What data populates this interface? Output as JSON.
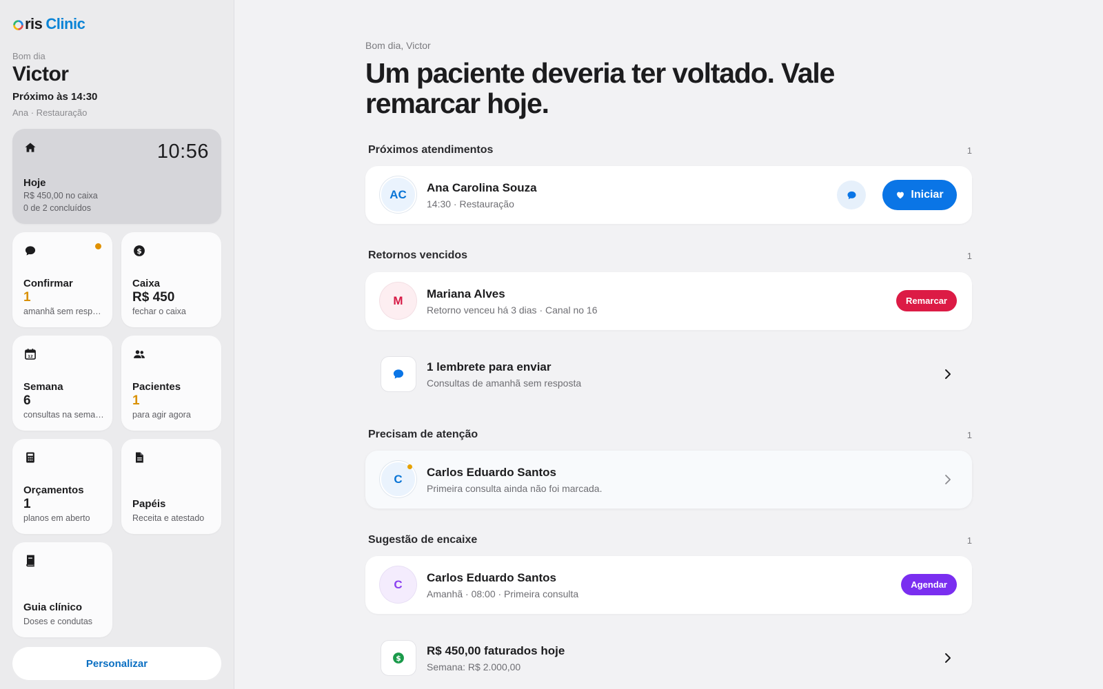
{
  "brand": {
    "prefix": "ris",
    "name": "Clinic"
  },
  "sidebar": {
    "greeting": "Bom dia",
    "user_name": "Victor",
    "next_appointment": "Próximo às 14:30",
    "next_detail": "Ana · Restauração",
    "today": {
      "title": "Hoje",
      "time": "10:56",
      "cash": "R$ 450,00 no caixa",
      "progress": "0 de 2 concluídos"
    },
    "tiles": [
      {
        "title": "Confirmar",
        "value": "1",
        "sub": "amanhã sem resposta",
        "icon": "chat-bubble-icon"
      },
      {
        "title": "Caixa",
        "value": "R$ 450",
        "sub": "fechar o caixa",
        "icon": "dollar-coin-icon"
      },
      {
        "title": "Semana",
        "value": "6",
        "sub": "consultas na semana",
        "icon": "calendar-icon"
      },
      {
        "title": "Pacientes",
        "value": "1",
        "sub": "para agir agora",
        "icon": "people-icon"
      },
      {
        "title": "Orçamentos",
        "value": "1",
        "sub": "planos em aberto",
        "icon": "calculator-icon"
      },
      {
        "title": "Papéis",
        "sub": "Receita e atestado",
        "icon": "document-icon"
      },
      {
        "title": "Guia clínico",
        "sub": "Doses e condutas",
        "icon": "book-icon"
      }
    ],
    "personalize_label": "Personalizar"
  },
  "main": {
    "hello": "Bom dia, Victor",
    "headline": "Um paciente deveria ter voltado. Vale remarcar hoje.",
    "upcoming": {
      "title": "Próximos atendimentos",
      "count": "1",
      "card": {
        "initials": "AC",
        "name": "Ana Carolina Souza",
        "sub": "14:30 · Restauração",
        "action": "Iniciar"
      }
    },
    "overdue": {
      "title": "Retornos vencidos",
      "count": "1",
      "card": {
        "initials": "M",
        "name": "Mariana Alves",
        "sub": "Retorno venceu há 3 dias · Canal no 16",
        "action": "Remarcar"
      }
    },
    "reminder": {
      "title": "1 lembrete para enviar",
      "sub": "Consultas de amanhã sem resposta"
    },
    "attention": {
      "title": "Precisam de atenção",
      "count": "1",
      "card": {
        "initials": "C",
        "name": "Carlos Eduardo Santos",
        "sub": "Primeira consulta ainda não foi marcada."
      }
    },
    "suggestion": {
      "title": "Sugestão de encaixe",
      "count": "1",
      "card": {
        "initials": "C",
        "name": "Carlos Eduardo Santos",
        "sub": "Amanhã · 08:00 · Primeira consulta",
        "action": "Agendar"
      }
    },
    "revenue": {
      "title": "R$ 450,00 faturados hoje",
      "sub": "Semana: R$ 2.000,00"
    }
  },
  "colors": {
    "accent_blue": "#0a75e6",
    "warning_orange": "#d99000",
    "danger_red": "#dc1b45",
    "purple": "#7a2ef0",
    "money_green": "#1a9a4a"
  }
}
